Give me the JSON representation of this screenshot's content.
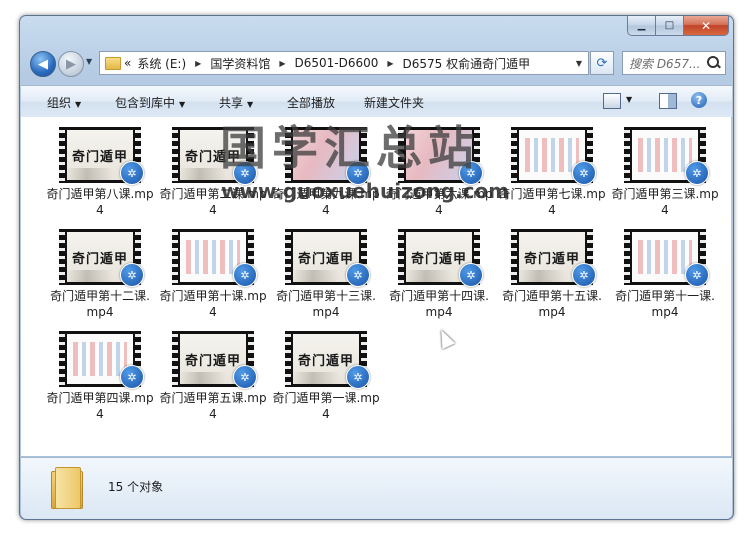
{
  "window": {
    "caption_min": "▁",
    "caption_max": "□",
    "caption_close": "✕"
  },
  "nav": {
    "back_glyph": "◀",
    "forward_glyph": "▶",
    "refresh_glyph": "⟳",
    "breadcrumbs": [
      "«",
      "系统 (E:)",
      "国学资料馆",
      "D6501-D6600",
      "D6575 权俞通奇门遁甲"
    ],
    "search_placeholder": "搜索 D657..."
  },
  "toolbar": {
    "organize": "组织",
    "include_in_library": "包含到库中",
    "share": "共享",
    "play_all": "全部播放",
    "new_folder": "新建文件夹",
    "help_glyph": "?"
  },
  "files": [
    {
      "name": "奇门遁甲第八课.mp4",
      "thumb": "title"
    },
    {
      "name": "奇门遁甲第二课.mp4",
      "thumb": "title"
    },
    {
      "name": "奇门遁甲第九课.mp4",
      "thumb": "pink"
    },
    {
      "name": "奇门遁甲第六课.mp4",
      "thumb": "pink"
    },
    {
      "name": "奇门遁甲第七课.mp4",
      "thumb": "doc"
    },
    {
      "name": "奇门遁甲第三课.mp4",
      "thumb": "doc"
    },
    {
      "name": "奇门遁甲第十二课.mp4",
      "thumb": "title"
    },
    {
      "name": "奇门遁甲第十课.mp4",
      "thumb": "doc"
    },
    {
      "name": "奇门遁甲第十三课.mp4",
      "thumb": "title"
    },
    {
      "name": "奇门遁甲第十四课.mp4",
      "thumb": "title"
    },
    {
      "name": "奇门遁甲第十五课.mp4",
      "thumb": "title"
    },
    {
      "name": "奇门遁甲第十一课.mp4",
      "thumb": "doc"
    },
    {
      "name": "奇门遁甲第四课.mp4",
      "thumb": "doc"
    },
    {
      "name": "奇门遁甲第五课.mp4",
      "thumb": "title"
    },
    {
      "name": "奇门遁甲第一课.mp4",
      "thumb": "title"
    }
  ],
  "thumb_title_text": "奇门遁甲",
  "watermark": {
    "text": "国学汇总站",
    "url": "www.guoxuehuizong.com"
  },
  "details": {
    "count": "15 个对象"
  }
}
